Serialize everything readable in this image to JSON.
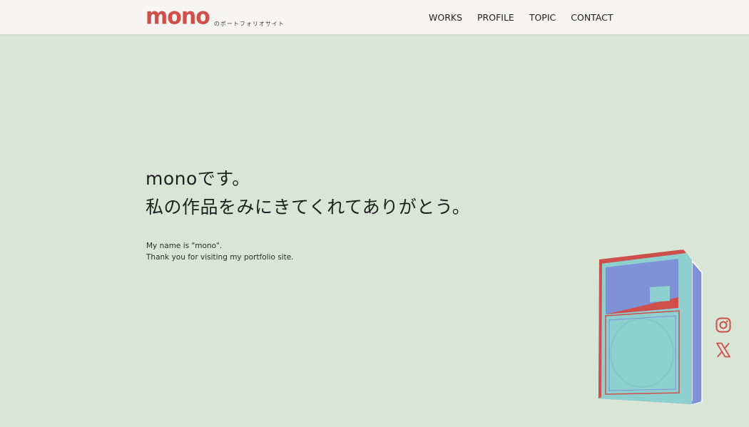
{
  "header": {
    "logo_text": "mono",
    "logo_subtitle": "のポートフォリオサイト",
    "nav": [
      {
        "label": "WORKS"
      },
      {
        "label": "PROFILE"
      },
      {
        "label": "TOPIC"
      },
      {
        "label": "CONTACT"
      }
    ]
  },
  "hero": {
    "jp_line1": "monoです。",
    "jp_line2": "私の作品をみにきてくれてありがとう。",
    "en_line1": "My name is \"mono\".",
    "en_line2": "Thank you for visiting my portfolio site."
  },
  "illustration": {
    "name": "speaker-illustration",
    "colors": {
      "front": "#8ecfcf",
      "side": "#7f92d6",
      "accent": "#cf4f4a"
    }
  },
  "social": [
    {
      "icon": "instagram-icon"
    },
    {
      "icon": "x-icon"
    }
  ],
  "colors": {
    "background": "#dae6d5",
    "header_bg": "#f6f5f3",
    "brand": "#cf4f4a"
  }
}
